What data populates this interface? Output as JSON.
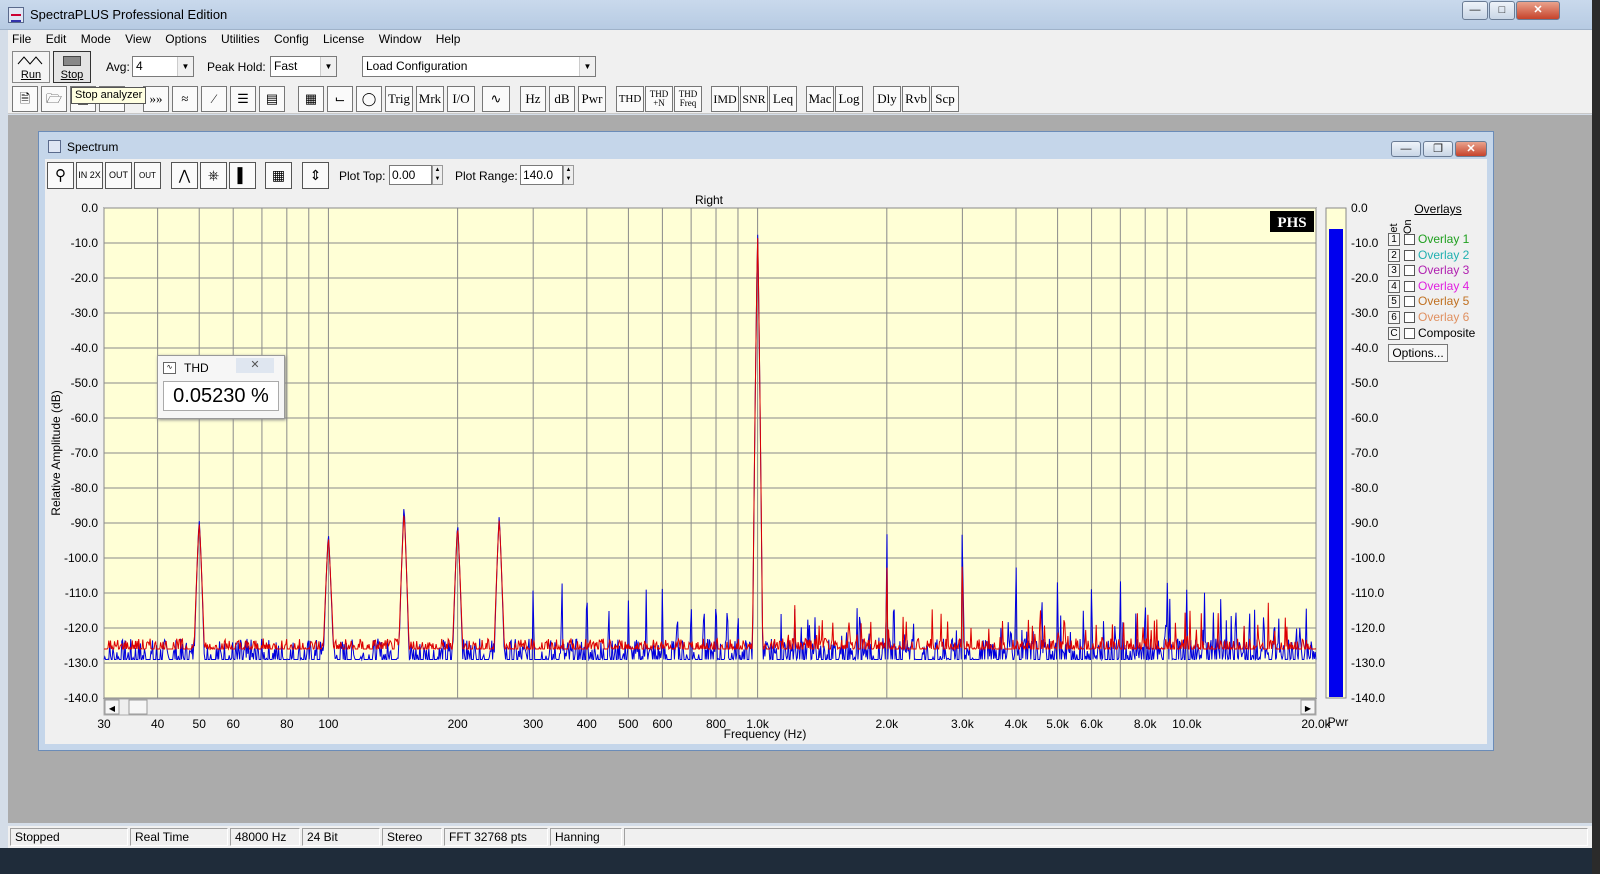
{
  "window": {
    "title": "SpectraPLUS Professional Edition"
  },
  "menu": [
    "File",
    "Edit",
    "Mode",
    "View",
    "Options",
    "Utilities",
    "Config",
    "License",
    "Window",
    "Help"
  ],
  "toolbar": {
    "run_label": "Run",
    "stop_label": "Stop",
    "avg_label": "Avg:",
    "avg_value": "4",
    "peak_hold_label": "Peak Hold:",
    "peak_hold_value": "Fast",
    "load_config": "Load Configuration",
    "tooltip": "Stop analyzer",
    "buttons": [
      "Trig",
      "Mrk",
      "I/O",
      "Hz",
      "dB",
      "Pwr",
      "THD",
      "THD +N",
      "THD Freq",
      "IMD",
      "SNR",
      "Leq",
      "Mac",
      "Log",
      "Dly",
      "Rvb",
      "Scp"
    ]
  },
  "spectrum_window": {
    "title": "Spectrum",
    "plot_top_label": "Plot Top:",
    "plot_top_value": "0.00",
    "plot_range_label": "Plot Range:",
    "plot_range_value": "140.0",
    "zoom_buttons": [
      "IN 2X",
      "OUT 2X",
      "OUT FULL"
    ]
  },
  "thd_box": {
    "title": "THD",
    "value": "0.05230 %"
  },
  "overlays": {
    "header": "Overlays",
    "col_set": "Set",
    "col_on": "On",
    "items": [
      {
        "key": "1",
        "label": "Overlay 1",
        "color": "#20a020"
      },
      {
        "key": "2",
        "label": "Overlay 2",
        "color": "#20b0b0"
      },
      {
        "key": "3",
        "label": "Overlay 3",
        "color": "#b020b0"
      },
      {
        "key": "4",
        "label": "Overlay 4",
        "color": "#e020e0"
      },
      {
        "key": "5",
        "label": "Overlay 5",
        "color": "#c07020"
      },
      {
        "key": "6",
        "label": "Overlay 6",
        "color": "#e09060"
      },
      {
        "key": "C",
        "label": "Composite",
        "color": "#000000"
      }
    ],
    "options_button": "Options..."
  },
  "status": [
    "Stopped",
    "Real Time",
    "48000 Hz",
    "24 Bit",
    "Stereo",
    "FFT 32768 pts",
    "Hanning"
  ],
  "chart_data": {
    "type": "line",
    "title": "Right",
    "xlabel": "Frequency (Hz)",
    "ylabel": "Relative Amplitude (dB)",
    "xscale": "log",
    "xlim": [
      30,
      20000
    ],
    "ylim": [
      -140,
      0
    ],
    "grid": true,
    "brand_mark": "PHS",
    "xticks": [
      30,
      40,
      50,
      60,
      80,
      100,
      200,
      300,
      400,
      500,
      600,
      800,
      1000,
      2000,
      3000,
      4000,
      5000,
      6000,
      8000,
      10000,
      20000
    ],
    "xtick_labels": [
      "30",
      "40",
      "50",
      "60",
      "80",
      "100",
      "200",
      "300",
      "400",
      "500",
      "600",
      "800",
      "1.0k",
      "2.0k",
      "3.0k",
      "4.0k",
      "5.0k",
      "6.0k",
      "8.0k",
      "10.0k",
      "20.0k"
    ],
    "yticks": [
      0,
      -10,
      -20,
      -30,
      -40,
      -50,
      -60,
      -70,
      -80,
      -90,
      -100,
      -110,
      -120,
      -130,
      -140
    ],
    "ytick_labels": [
      "0.0",
      "-10.0",
      "-20.0",
      "-30.0",
      "-40.0",
      "-50.0",
      "-60.0",
      "-70.0",
      "-80.0",
      "-90.0",
      "-100.0",
      "-110.0",
      "-120.0",
      "-130.0",
      "-140.0"
    ],
    "series": [
      {
        "color": "#0000dd",
        "floor": -129,
        "floor_var": 6,
        "peaks": [
          [
            50,
            -89
          ],
          [
            100,
            -93
          ],
          [
            150,
            -85
          ],
          [
            200,
            -90
          ],
          [
            250,
            -88
          ],
          [
            300,
            -107
          ],
          [
            350,
            -103
          ],
          [
            400,
            -105
          ],
          [
            450,
            -112
          ],
          [
            500,
            -112
          ],
          [
            550,
            -109
          ],
          [
            600,
            -108
          ],
          [
            650,
            -113
          ],
          [
            700,
            -110
          ],
          [
            750,
            -110
          ],
          [
            800,
            -108
          ],
          [
            850,
            -110
          ],
          [
            900,
            -113
          ],
          [
            1000,
            -7
          ],
          [
            2000,
            -89
          ],
          [
            3000,
            -82
          ],
          [
            4000,
            -97
          ],
          [
            5000,
            -104
          ],
          [
            6000,
            -105
          ],
          [
            7000,
            -104
          ],
          [
            8000,
            -109
          ],
          [
            9000,
            -104
          ],
          [
            10000,
            -108
          ],
          [
            11000,
            -109
          ],
          [
            12000,
            -110
          ],
          [
            13000,
            -111
          ],
          [
            14000,
            -113
          ],
          [
            16000,
            -115
          ],
          [
            18000,
            -118
          ]
        ]
      },
      {
        "color": "#dd0000",
        "floor": -126,
        "floor_var": 3,
        "peaks": [
          [
            50,
            -90
          ],
          [
            100,
            -94
          ],
          [
            150,
            -87
          ],
          [
            200,
            -91
          ],
          [
            250,
            -89
          ],
          [
            1000,
            -8
          ],
          [
            2000,
            -100
          ],
          [
            3000,
            -95
          ]
        ]
      }
    ],
    "power_meter": {
      "label": "Pwr",
      "level_db": -6
    }
  }
}
